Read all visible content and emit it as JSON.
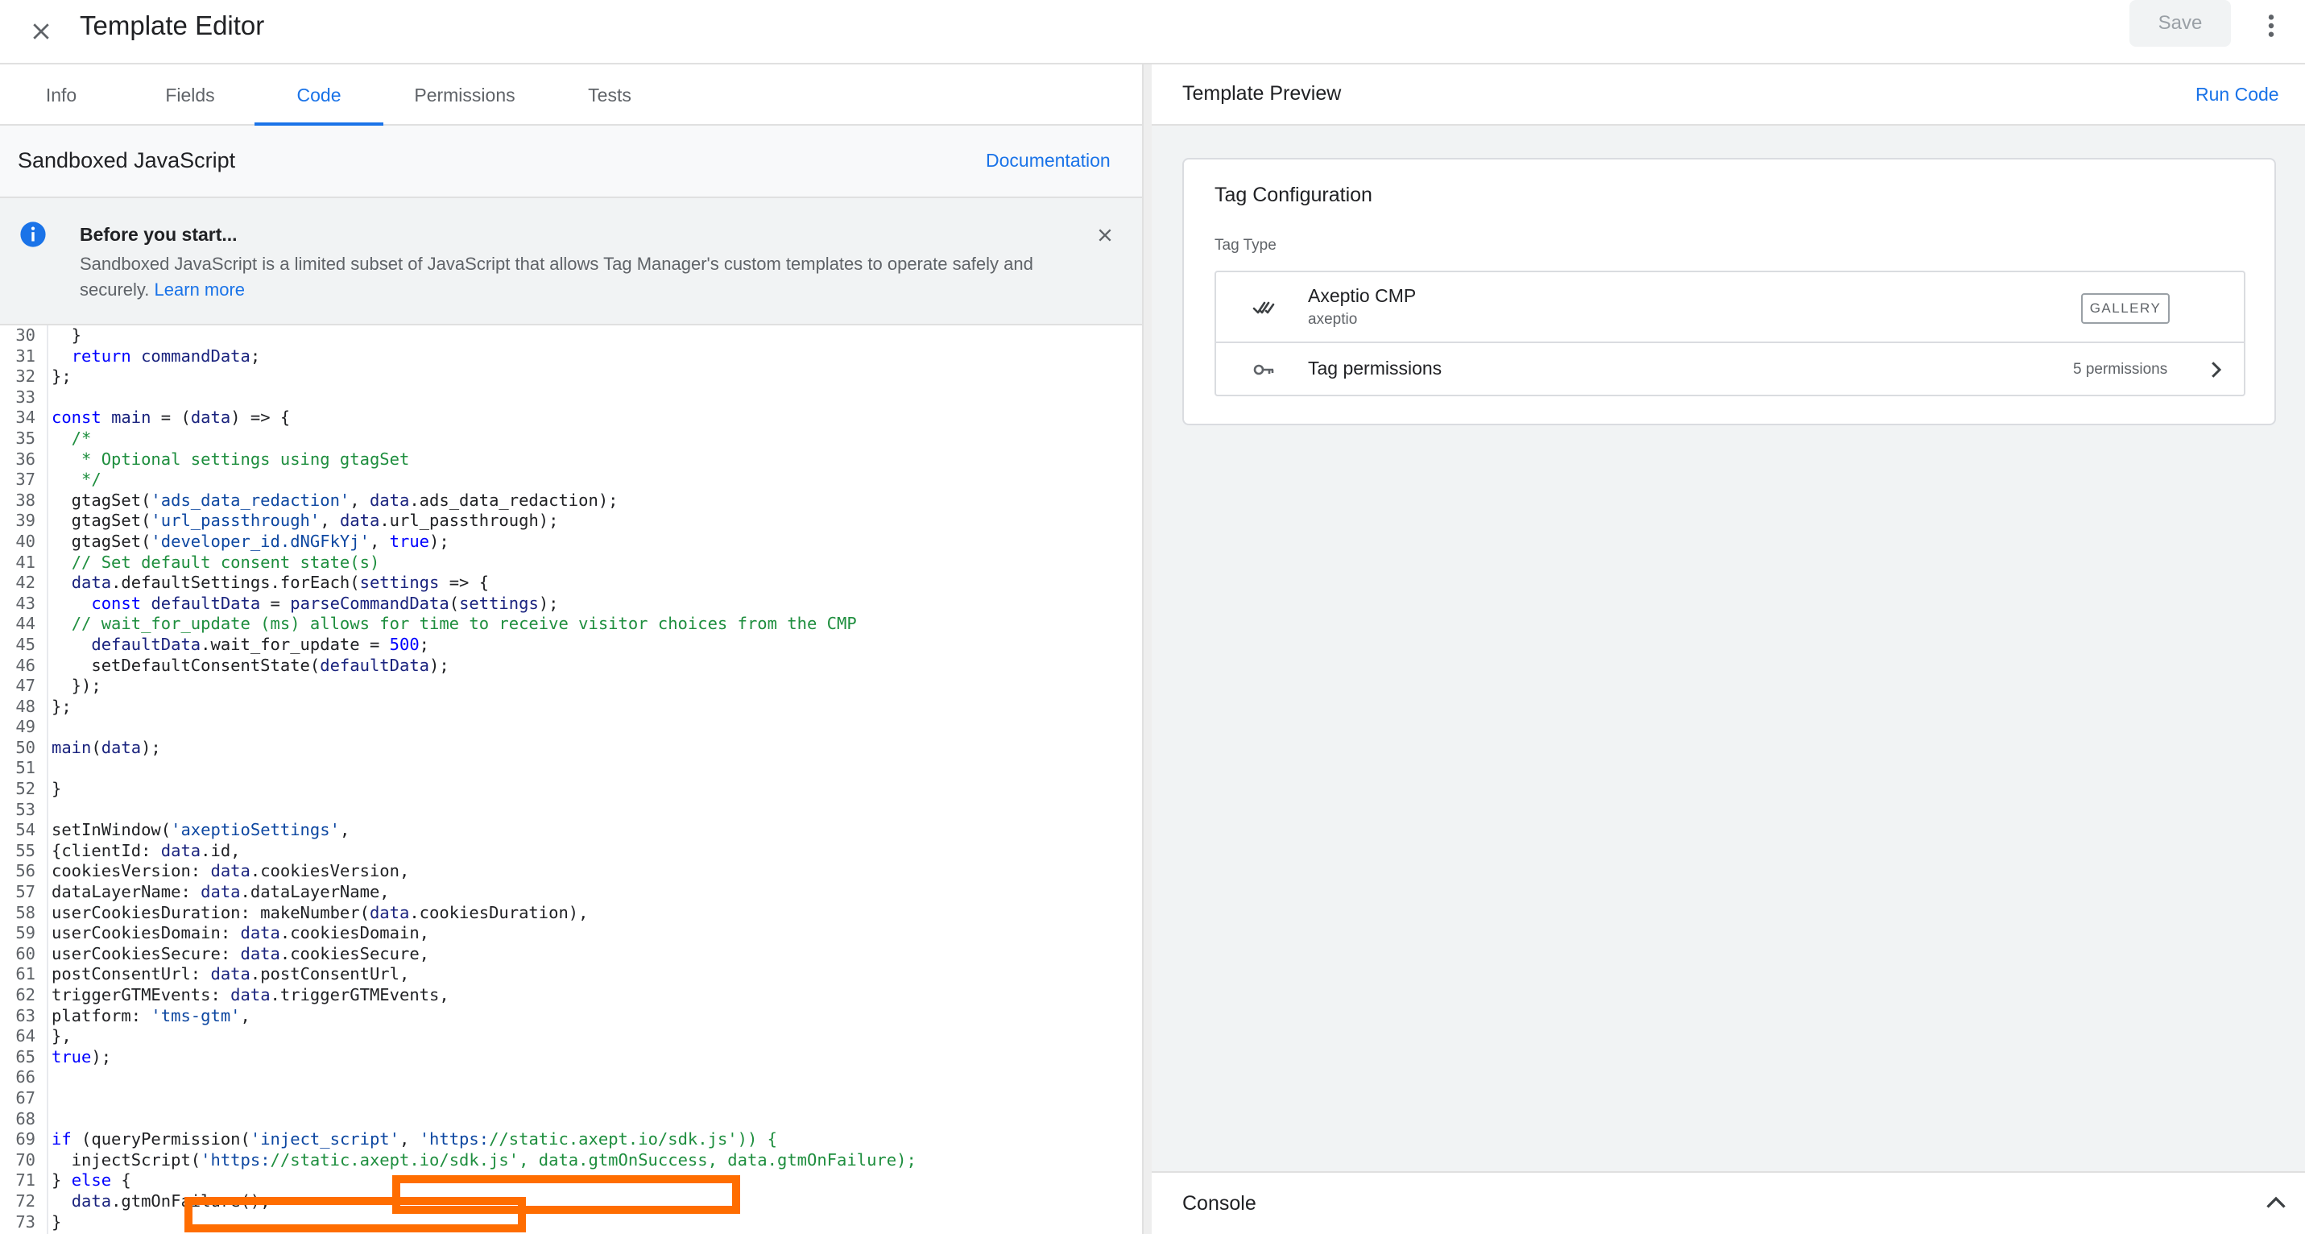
{
  "header": {
    "title": "Template Editor",
    "save_label": "Save"
  },
  "tabs": [
    "Info",
    "Fields",
    "Code",
    "Permissions",
    "Tests"
  ],
  "active_tab": "Code",
  "editor": {
    "section_title": "Sandboxed JavaScript",
    "doc_link": "Documentation"
  },
  "banner": {
    "title": "Before you start...",
    "body": "Sandboxed JavaScript is a limited subset of JavaScript that allows Tag Manager's custom templates to operate safely and securely.",
    "link": "Learn more"
  },
  "code_lines": [
    {
      "n": "30",
      "t": "  }"
    },
    {
      "n": "31",
      "t": "  return commandData;"
    },
    {
      "n": "32",
      "t": "};"
    },
    {
      "n": "33",
      "t": ""
    },
    {
      "n": "34",
      "t": "const main = (data) => {"
    },
    {
      "n": "35",
      "t": "  /*"
    },
    {
      "n": "36",
      "t": "   * Optional settings using gtagSet"
    },
    {
      "n": "37",
      "t": "   */"
    },
    {
      "n": "38",
      "t": "  gtagSet('ads_data_redaction', data.ads_data_redaction);"
    },
    {
      "n": "39",
      "t": "  gtagSet('url_passthrough', data.url_passthrough);"
    },
    {
      "n": "40",
      "t": "  gtagSet('developer_id.dNGFkYj', true);"
    },
    {
      "n": "41",
      "t": "  // Set default consent state(s)"
    },
    {
      "n": "42",
      "t": "  data.defaultSettings.forEach(settings => {"
    },
    {
      "n": "43",
      "t": "    const defaultData = parseCommandData(settings);"
    },
    {
      "n": "44",
      "t": "  // wait_for_update (ms) allows for time to receive visitor choices from the CMP"
    },
    {
      "n": "45",
      "t": "    defaultData.wait_for_update = 500;"
    },
    {
      "n": "46",
      "t": "    setDefaultConsentState(defaultData);"
    },
    {
      "n": "47",
      "t": "  });"
    },
    {
      "n": "48",
      "t": "};"
    },
    {
      "n": "49",
      "t": ""
    },
    {
      "n": "50",
      "t": "main(data);"
    },
    {
      "n": "51",
      "t": ""
    },
    {
      "n": "52",
      "t": "}"
    },
    {
      "n": "53",
      "t": ""
    },
    {
      "n": "54",
      "t": "setInWindow('axeptioSettings',"
    },
    {
      "n": "55",
      "t": "{clientId: data.id,"
    },
    {
      "n": "56",
      "t": "cookiesVersion: data.cookiesVersion,"
    },
    {
      "n": "57",
      "t": "dataLayerName: data.dataLayerName,"
    },
    {
      "n": "58",
      "t": "userCookiesDuration: makeNumber(data.cookiesDuration),"
    },
    {
      "n": "59",
      "t": "userCookiesDomain: data.cookiesDomain,"
    },
    {
      "n": "60",
      "t": "userCookiesSecure: data.cookiesSecure,"
    },
    {
      "n": "61",
      "t": "postConsentUrl: data.postConsentUrl,"
    },
    {
      "n": "62",
      "t": "triggerGTMEvents: data.triggerGTMEvents,"
    },
    {
      "n": "63",
      "t": "platform: 'tms-gtm',"
    },
    {
      "n": "64",
      "t": "},"
    },
    {
      "n": "65",
      "t": "true);"
    },
    {
      "n": "66",
      "t": ""
    },
    {
      "n": "67",
      "t": ""
    },
    {
      "n": "68",
      "t": ""
    },
    {
      "n": "69",
      "t": "if (queryPermission('inject_script', 'https://static.axept.io/sdk.js')) {"
    },
    {
      "n": "70",
      "t": "  injectScript('https://static.axept.io/sdk.js', data.gtmOnSuccess, data.gtmOnFailure);"
    },
    {
      "n": "71",
      "t": "} else {"
    },
    {
      "n": "72",
      "t": "  data.gtmOnFailure();"
    },
    {
      "n": "73",
      "t": "}"
    }
  ],
  "preview": {
    "title": "Template Preview",
    "run_label": "Run Code",
    "card_title": "Tag Configuration",
    "tag_type_label": "Tag Type",
    "tag_name": "Axeptio CMP",
    "tag_vendor": "axeptio",
    "gallery_badge": "GALLERY",
    "permissions_label": "Tag permissions",
    "permissions_count": "5 permissions"
  },
  "console": {
    "title": "Console"
  },
  "colors": {
    "accent": "#1a73e8",
    "highlight_box": "#ff6d00",
    "comment": "#1e8e3e",
    "keyword": "#0000ff",
    "string": "#0d47a1"
  },
  "icons": {
    "close": "close-icon",
    "more": "more-vert-icon",
    "info": "info-icon",
    "banner_close": "close-icon",
    "tag": "axeptio-logo-icon",
    "key": "key-icon",
    "chevron": "chevron-right-icon",
    "console": "chevron-up-icon"
  }
}
